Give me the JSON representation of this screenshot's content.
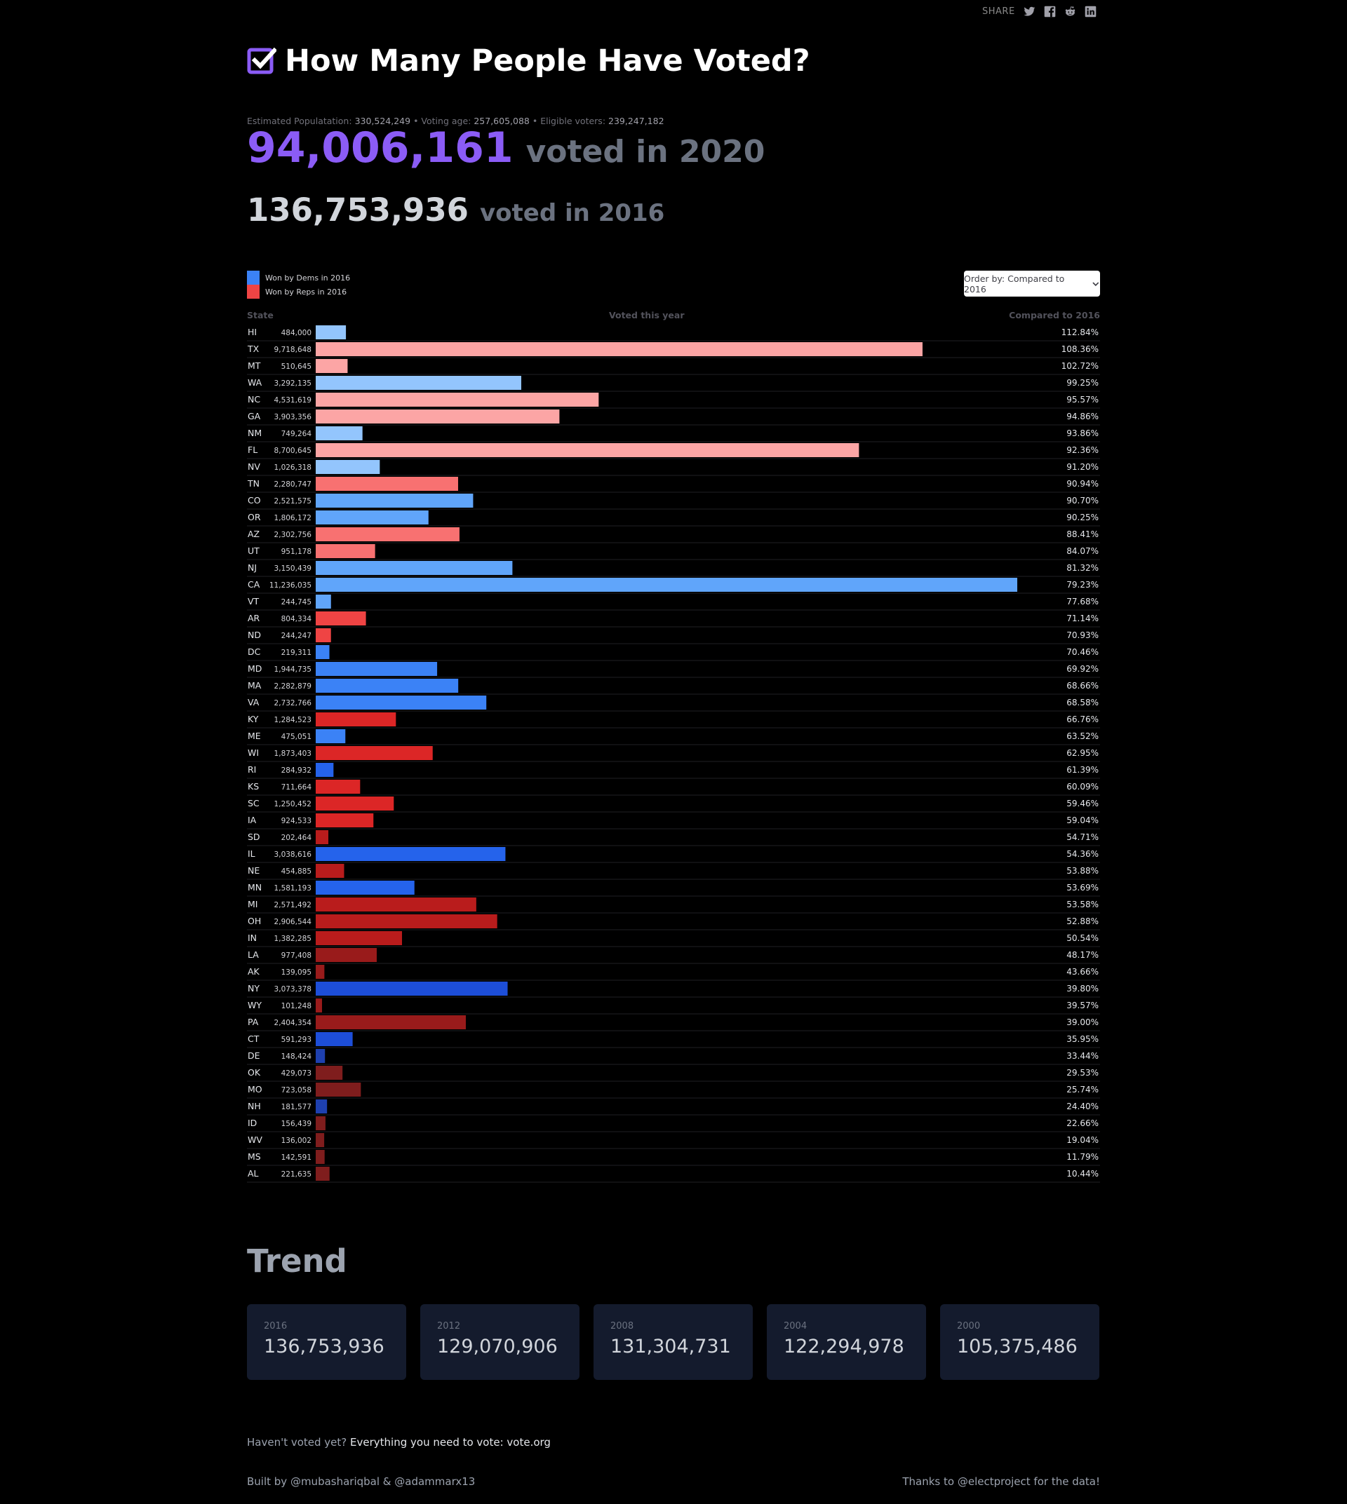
{
  "share": {
    "label": "SHARE"
  },
  "header": {
    "title": "How Many People Have Voted?"
  },
  "stats": {
    "population_label": "Estimated Populatation:",
    "population": "330,524,249",
    "sep1": " • ",
    "voting_age_label": "Voting age:",
    "voting_age": "257,605,088",
    "sep2": " • ",
    "eligible_label": "Eligible voters:",
    "eligible": "239,247,182"
  },
  "totals": {
    "voted_2020": "94,006,161",
    "voted_2020_label": "voted in 2020",
    "voted_2016": "136,753,936",
    "voted_2016_label": "voted in 2016"
  },
  "legend": {
    "dems": {
      "label": "Won by Dems in 2016",
      "color": "#3b82f6"
    },
    "reps": {
      "label": "Won by Reps in 2016",
      "color": "#ef4444"
    }
  },
  "order": {
    "label": "Order by: Compared to 2016"
  },
  "chart_data": {
    "type": "bar",
    "columns": {
      "state": "State",
      "voted": "Voted this year",
      "compared": "Compared to 2016"
    },
    "rows": [
      {
        "state": "HI",
        "voted": 484000,
        "voted_label": "484,000",
        "pct": "112.84%",
        "party": "D"
      },
      {
        "state": "TX",
        "voted": 9718648,
        "voted_label": "9,718,648",
        "pct": "108.36%",
        "party": "R"
      },
      {
        "state": "MT",
        "voted": 510645,
        "voted_label": "510,645",
        "pct": "102.72%",
        "party": "R"
      },
      {
        "state": "WA",
        "voted": 3292135,
        "voted_label": "3,292,135",
        "pct": "99.25%",
        "party": "D"
      },
      {
        "state": "NC",
        "voted": 4531619,
        "voted_label": "4,531,619",
        "pct": "95.57%",
        "party": "R"
      },
      {
        "state": "GA",
        "voted": 3903356,
        "voted_label": "3,903,356",
        "pct": "94.86%",
        "party": "R"
      },
      {
        "state": "NM",
        "voted": 749264,
        "voted_label": "749,264",
        "pct": "93.86%",
        "party": "D"
      },
      {
        "state": "FL",
        "voted": 8700645,
        "voted_label": "8,700,645",
        "pct": "92.36%",
        "party": "R"
      },
      {
        "state": "NV",
        "voted": 1026318,
        "voted_label": "1,026,318",
        "pct": "91.20%",
        "party": "D"
      },
      {
        "state": "TN",
        "voted": 2280747,
        "voted_label": "2,280,747",
        "pct": "90.94%",
        "party": "R"
      },
      {
        "state": "CO",
        "voted": 2521575,
        "voted_label": "2,521,575",
        "pct": "90.70%",
        "party": "D"
      },
      {
        "state": "OR",
        "voted": 1806172,
        "voted_label": "1,806,172",
        "pct": "90.25%",
        "party": "D"
      },
      {
        "state": "AZ",
        "voted": 2302756,
        "voted_label": "2,302,756",
        "pct": "88.41%",
        "party": "R"
      },
      {
        "state": "UT",
        "voted": 951178,
        "voted_label": "951,178",
        "pct": "84.07%",
        "party": "R"
      },
      {
        "state": "NJ",
        "voted": 3150439,
        "voted_label": "3,150,439",
        "pct": "81.32%",
        "party": "D"
      },
      {
        "state": "CA",
        "voted": 11236035,
        "voted_label": "11,236,035",
        "pct": "79.23%",
        "party": "D"
      },
      {
        "state": "VT",
        "voted": 244745,
        "voted_label": "244,745",
        "pct": "77.68%",
        "party": "D"
      },
      {
        "state": "AR",
        "voted": 804334,
        "voted_label": "804,334",
        "pct": "71.14%",
        "party": "R"
      },
      {
        "state": "ND",
        "voted": 244247,
        "voted_label": "244,247",
        "pct": "70.93%",
        "party": "R"
      },
      {
        "state": "DC",
        "voted": 219311,
        "voted_label": "219,311",
        "pct": "70.46%",
        "party": "D"
      },
      {
        "state": "MD",
        "voted": 1944735,
        "voted_label": "1,944,735",
        "pct": "69.92%",
        "party": "D"
      },
      {
        "state": "MA",
        "voted": 2282879,
        "voted_label": "2,282,879",
        "pct": "68.66%",
        "party": "D"
      },
      {
        "state": "VA",
        "voted": 2732766,
        "voted_label": "2,732,766",
        "pct": "68.58%",
        "party": "D"
      },
      {
        "state": "KY",
        "voted": 1284523,
        "voted_label": "1,284,523",
        "pct": "66.76%",
        "party": "R"
      },
      {
        "state": "ME",
        "voted": 475051,
        "voted_label": "475,051",
        "pct": "63.52%",
        "party": "D"
      },
      {
        "state": "WI",
        "voted": 1873403,
        "voted_label": "1,873,403",
        "pct": "62.95%",
        "party": "R"
      },
      {
        "state": "RI",
        "voted": 284932,
        "voted_label": "284,932",
        "pct": "61.39%",
        "party": "D"
      },
      {
        "state": "KS",
        "voted": 711664,
        "voted_label": "711,664",
        "pct": "60.09%",
        "party": "R"
      },
      {
        "state": "SC",
        "voted": 1250452,
        "voted_label": "1,250,452",
        "pct": "59.46%",
        "party": "R"
      },
      {
        "state": "IA",
        "voted": 924533,
        "voted_label": "924,533",
        "pct": "59.04%",
        "party": "R"
      },
      {
        "state": "SD",
        "voted": 202464,
        "voted_label": "202,464",
        "pct": "54.71%",
        "party": "R"
      },
      {
        "state": "IL",
        "voted": 3038616,
        "voted_label": "3,038,616",
        "pct": "54.36%",
        "party": "D"
      },
      {
        "state": "NE",
        "voted": 454885,
        "voted_label": "454,885",
        "pct": "53.88%",
        "party": "R"
      },
      {
        "state": "MN",
        "voted": 1581193,
        "voted_label": "1,581,193",
        "pct": "53.69%",
        "party": "D"
      },
      {
        "state": "MI",
        "voted": 2571492,
        "voted_label": "2,571,492",
        "pct": "53.58%",
        "party": "R"
      },
      {
        "state": "OH",
        "voted": 2906544,
        "voted_label": "2,906,544",
        "pct": "52.88%",
        "party": "R"
      },
      {
        "state": "IN",
        "voted": 1382285,
        "voted_label": "1,382,285",
        "pct": "50.54%",
        "party": "R"
      },
      {
        "state": "LA",
        "voted": 977408,
        "voted_label": "977,408",
        "pct": "48.17%",
        "party": "R"
      },
      {
        "state": "AK",
        "voted": 139095,
        "voted_label": "139,095",
        "pct": "43.66%",
        "party": "R"
      },
      {
        "state": "NY",
        "voted": 3073378,
        "voted_label": "3,073,378",
        "pct": "39.80%",
        "party": "D"
      },
      {
        "state": "WY",
        "voted": 101248,
        "voted_label": "101,248",
        "pct": "39.57%",
        "party": "R"
      },
      {
        "state": "PA",
        "voted": 2404354,
        "voted_label": "2,404,354",
        "pct": "39.00%",
        "party": "R"
      },
      {
        "state": "CT",
        "voted": 591293,
        "voted_label": "591,293",
        "pct": "35.95%",
        "party": "D"
      },
      {
        "state": "DE",
        "voted": 148424,
        "voted_label": "148,424",
        "pct": "33.44%",
        "party": "D"
      },
      {
        "state": "OK",
        "voted": 429073,
        "voted_label": "429,073",
        "pct": "29.53%",
        "party": "R"
      },
      {
        "state": "MO",
        "voted": 723058,
        "voted_label": "723,058",
        "pct": "25.74%",
        "party": "R"
      },
      {
        "state": "NH",
        "voted": 181577,
        "voted_label": "181,577",
        "pct": "24.40%",
        "party": "D"
      },
      {
        "state": "ID",
        "voted": 156439,
        "voted_label": "156,439",
        "pct": "22.66%",
        "party": "R"
      },
      {
        "state": "WV",
        "voted": 136002,
        "voted_label": "136,002",
        "pct": "19.04%",
        "party": "R"
      },
      {
        "state": "MS",
        "voted": 142591,
        "voted_label": "142,591",
        "pct": "11.79%",
        "party": "R"
      },
      {
        "state": "AL",
        "voted": 221635,
        "voted_label": "221,635",
        "pct": "10.44%",
        "party": "R"
      }
    ],
    "dem_shades": [
      "#93c5fd",
      "#60a5fa",
      "#3b82f6",
      "#2563eb",
      "#1d4ed8",
      "#1e40af"
    ],
    "rep_shades": [
      "#fca5a5",
      "#f87171",
      "#ef4444",
      "#dc2626",
      "#b91c1c",
      "#991b1b",
      "#7f1d1d"
    ]
  },
  "trend": {
    "title": "Trend",
    "cards": [
      {
        "year": "2016",
        "value": "136,753,936"
      },
      {
        "year": "2012",
        "value": "129,070,906"
      },
      {
        "year": "2008",
        "value": "131,304,731"
      },
      {
        "year": "2004",
        "value": "122,294,978"
      },
      {
        "year": "2000",
        "value": "105,375,486"
      }
    ]
  },
  "footer": {
    "cta_prefix": "Haven't voted yet?",
    "cta_link": "Everything you need to vote: vote.org",
    "built_by": "Built by @mubashariqbal & @adammarx13",
    "thanks": "Thanks to @electproject for the data!"
  }
}
